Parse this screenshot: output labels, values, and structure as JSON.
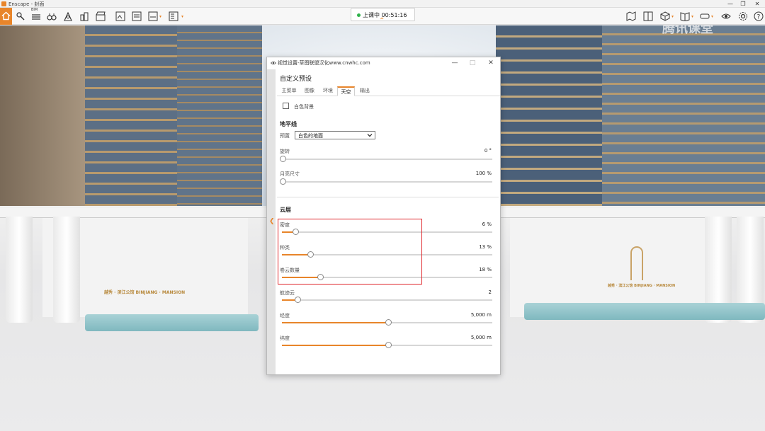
{
  "window": {
    "app_title": "Enscape - 封面",
    "minimize": "—",
    "maximize": "❐",
    "close": "✕"
  },
  "toolbar": {
    "bim_label": "BIM",
    "status_text": "上课中 00:51:16",
    "accent_color": "#e8852a",
    "left_icons": [
      "home-icon",
      "tools-icon",
      "list-icon",
      "binoculars-icon",
      "people-icon",
      "map-pin-icon",
      "buildings-icon",
      "clapper-icon",
      "export-image-icon",
      "export-batch-icon",
      "export-360-icon",
      "export-exe-icon"
    ],
    "right_icons": [
      "map-icon",
      "panel-icon",
      "cube-icon",
      "book-icon",
      "vr-headset-icon",
      "eye-icon",
      "gear-icon",
      "help-icon"
    ]
  },
  "viewport": {
    "watermark": "腾讯课堂",
    "sign_left": "越秀 · 滨江公馆  BINJIANG · MANSION",
    "sign_right": "越秀 · 滨江公馆  BINJIANG · MANSION"
  },
  "dialog": {
    "title": "视觉设置-草图联盟汉化www.cnwhc.com",
    "close": "✕",
    "maximize": "□",
    "minimize": "—",
    "preset_title": "自定义预设",
    "tabs": [
      {
        "label": "主菜单",
        "active": false
      },
      {
        "label": "图像",
        "active": false
      },
      {
        "label": "环境",
        "active": false
      },
      {
        "label": "天空",
        "active": true
      },
      {
        "label": "输出",
        "active": false
      }
    ],
    "white_background": {
      "label": "白色背景",
      "checked": false
    },
    "horizon": {
      "section_title": "地平线",
      "preset_label": "预置",
      "preset_value": "白色的地面",
      "rotation": {
        "label": "旋转",
        "value_text": "0 °",
        "fraction": 0.0
      },
      "moon_size": {
        "label": "月亮尺寸",
        "value_text": "100 %",
        "fraction": 0.0
      }
    },
    "clouds": {
      "section_title": "云层",
      "density": {
        "label": "密度",
        "value_text": "6 %",
        "fraction": 0.06
      },
      "variety": {
        "label": "种类",
        "value_text": "13 %",
        "fraction": 0.13
      },
      "cirrus_amount": {
        "label": "卷云数量",
        "value_text": "18 %",
        "fraction": 0.18
      },
      "contrails": {
        "label": "航迹云",
        "value_text": "2",
        "fraction": 0.07
      },
      "longitude": {
        "label": "经度",
        "value_text": "5,000 m",
        "fraction": 0.5
      },
      "latitude": {
        "label": "纬度",
        "value_text": "5,000 m",
        "fraction": 0.5
      }
    }
  }
}
